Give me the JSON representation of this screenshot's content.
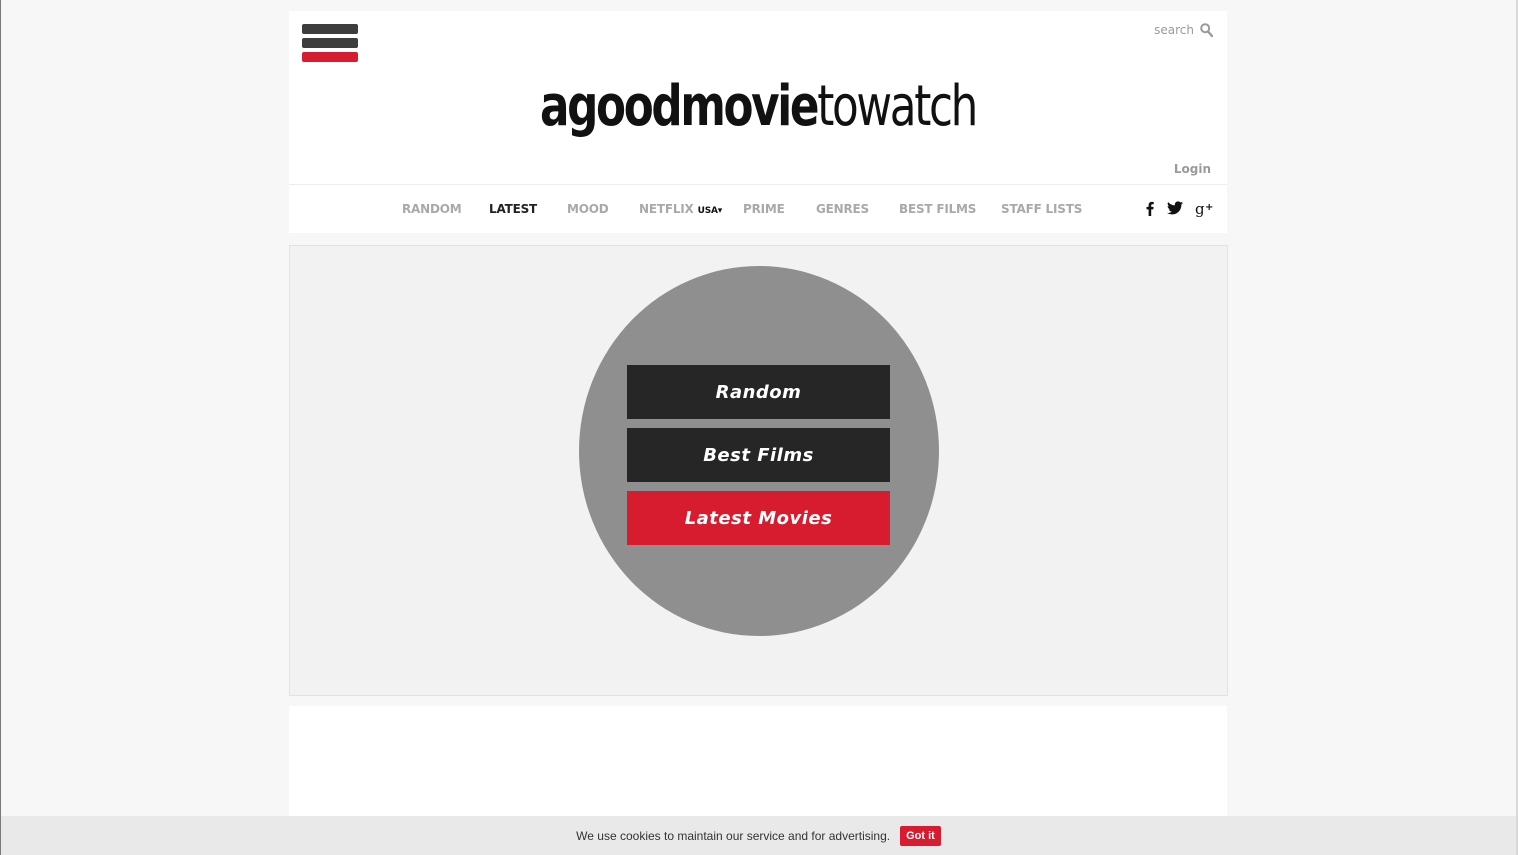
{
  "colors": {
    "accent": "#d81c2f",
    "dark_button": "#262626",
    "hamburger_dark": "#3d3d3d",
    "circle": "#8f8f8f"
  },
  "header": {
    "search_placeholder": "search",
    "search_icon": "magnifier-icon",
    "logo_bold": "agoodmovie",
    "logo_light": "towatch",
    "login_label": "Login"
  },
  "nav": {
    "items": [
      "RANDOM",
      "LATEST",
      "MOOD",
      "NETFLIX",
      "PRIME",
      "GENRES",
      "BEST FILMS",
      "STAFF LISTS"
    ],
    "active": "LATEST",
    "netflix_region": "USA▾"
  },
  "social": {
    "facebook": "facebook-icon",
    "twitter": "twitter-icon",
    "googleplus": "google-plus-icon"
  },
  "hero": {
    "buttons": [
      "Random",
      "Best Films",
      "Latest Movies"
    ]
  },
  "cookie": {
    "message": "We use cookies to maintain our service and for advertising.",
    "button_label": "Got it"
  }
}
